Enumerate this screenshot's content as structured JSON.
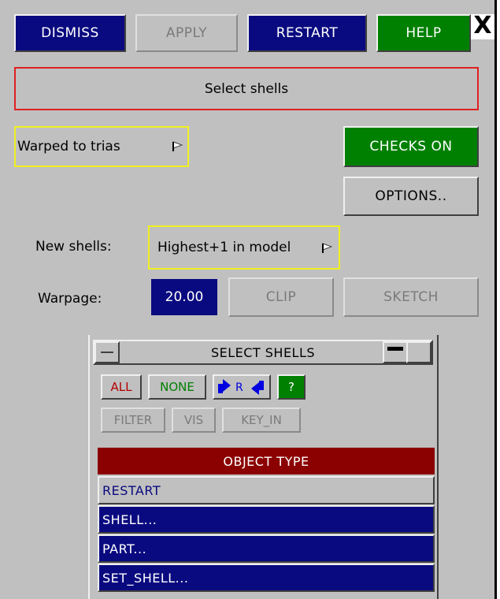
{
  "toolbar": {
    "dismiss": "DISMISS",
    "apply": "APPLY",
    "restart": "RESTART",
    "help": "HELP",
    "close": "X"
  },
  "select_bar": "Select shells",
  "mode_dropdown": "Warped to trias",
  "checks_button": "CHECKS ON",
  "options_button": "OPTIONS..",
  "new_shells": {
    "label": "New shells:",
    "value": "Highest+1 in model"
  },
  "warpage": {
    "label": "Warpage:",
    "value": "20.00",
    "clip": "CLIP",
    "sketch": "SKETCH"
  },
  "select_shells_window": {
    "title": "SELECT SHELLS",
    "buttons": {
      "all": "ALL",
      "none": "NONE",
      "reverse": "R",
      "help": "?",
      "filter": "FILTER",
      "vis": "VIS",
      "key_in": "KEY_IN"
    },
    "object_type_header": "OBJECT TYPE",
    "items": [
      "RESTART",
      "SHELL...",
      "PART...",
      "SET_SHELL..."
    ]
  },
  "colors": {
    "panel_bg": "#c0c0c0",
    "navy": "#0a0a80",
    "green": "#008000",
    "dark_red": "#8b0000",
    "highlight_yellow": "#f0f020",
    "select_border_red": "#e02020"
  }
}
